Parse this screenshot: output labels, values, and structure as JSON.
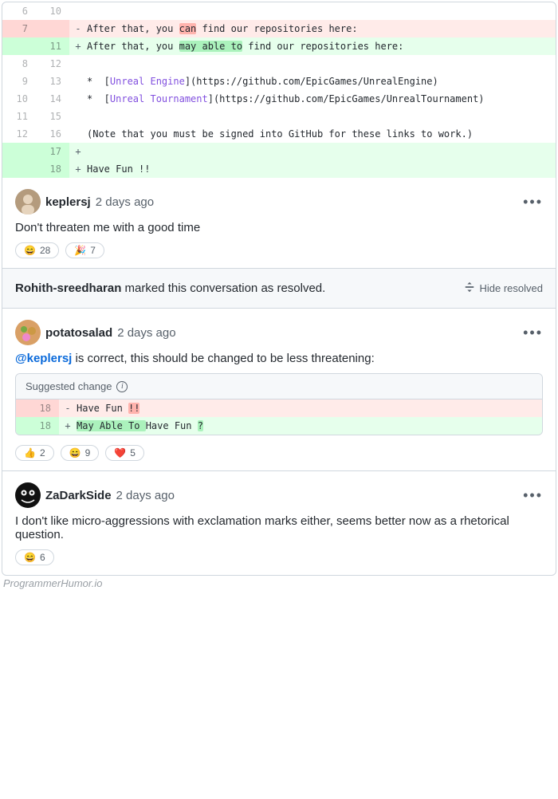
{
  "diff": {
    "rows": [
      {
        "type": "ctx",
        "l": "6",
        "r": "10",
        "sym": "",
        "code": [
          {
            "t": ""
          }
        ]
      },
      {
        "type": "del",
        "l": "7",
        "r": "",
        "sym": "-",
        "code": [
          {
            "t": "After that, you "
          },
          {
            "t": "can",
            "cls": "hl-del"
          },
          {
            "t": " find our repositories here:"
          }
        ]
      },
      {
        "type": "add",
        "l": "",
        "r": "11",
        "sym": "+",
        "code": [
          {
            "t": "After that, you "
          },
          {
            "t": "may able to",
            "cls": "hl-add"
          },
          {
            "t": " find our repositories here:"
          }
        ]
      },
      {
        "type": "ctx",
        "l": "8",
        "r": "12",
        "sym": "",
        "code": [
          {
            "t": ""
          }
        ]
      },
      {
        "type": "ctx",
        "l": "9",
        "r": "13",
        "sym": "",
        "code": [
          {
            "t": "*  ["
          },
          {
            "t": "Unreal Engine",
            "cls": "link"
          },
          {
            "t": "](https://github.com/EpicGames/UnrealEngine)"
          }
        ]
      },
      {
        "type": "ctx",
        "l": "10",
        "r": "14",
        "sym": "",
        "code": [
          {
            "t": "*  ["
          },
          {
            "t": "Unreal Tournament",
            "cls": "link"
          },
          {
            "t": "](https://github.com/EpicGames/UnrealTournament)"
          }
        ]
      },
      {
        "type": "ctx",
        "l": "11",
        "r": "15",
        "sym": "",
        "code": [
          {
            "t": ""
          }
        ]
      },
      {
        "type": "ctx",
        "l": "12",
        "r": "16",
        "sym": "",
        "code": [
          {
            "t": "(Note that you must be signed into GitHub for these links to work.)"
          }
        ]
      },
      {
        "type": "add",
        "l": "",
        "r": "17",
        "sym": "+",
        "code": [
          {
            "t": ""
          }
        ]
      },
      {
        "type": "add",
        "l": "",
        "r": "18",
        "sym": "+",
        "code": [
          {
            "t": "Have Fun !!"
          }
        ]
      }
    ]
  },
  "comment1": {
    "author": "keplersj",
    "time": "2 days ago",
    "body": "Don't threaten me with a good time",
    "reactions": [
      {
        "emoji": "😄",
        "count": "28"
      },
      {
        "emoji": "🎉",
        "count": "7"
      }
    ]
  },
  "resolved": {
    "user": "Rohith-sreedharan",
    "suffix": " marked this conversation as resolved.",
    "hide": "Hide resolved"
  },
  "comment2": {
    "author": "potatosalad",
    "time": "2 days ago",
    "body_pre": "@keplersj",
    "body_post": " is correct, this should be changed to be less threatening:",
    "suggest_label": "Suggested change",
    "suggest": {
      "rows": [
        {
          "type": "del",
          "num": "18",
          "sym": "-",
          "code": [
            {
              "t": "Have Fun "
            },
            {
              "t": "!!",
              "cls": "hl-del"
            }
          ]
        },
        {
          "type": "add",
          "num": "18",
          "sym": "+",
          "code": [
            {
              "t": "May Able To ",
              "cls": "hl-add"
            },
            {
              "t": "Have Fun "
            },
            {
              "t": "?",
              "cls": "hl-add"
            }
          ]
        }
      ]
    },
    "reactions": [
      {
        "emoji": "👍",
        "count": "2"
      },
      {
        "emoji": "😄",
        "count": "9"
      },
      {
        "emoji": "❤️",
        "count": "5"
      }
    ]
  },
  "comment3": {
    "author": "ZaDarkSide",
    "time": "2 days ago",
    "body": "I don't like micro-aggressions with exclamation marks either, seems better now as a rhetorical question.",
    "reactions": [
      {
        "emoji": "😄",
        "count": "6"
      }
    ]
  },
  "watermark": "ProgrammerHumor.io"
}
